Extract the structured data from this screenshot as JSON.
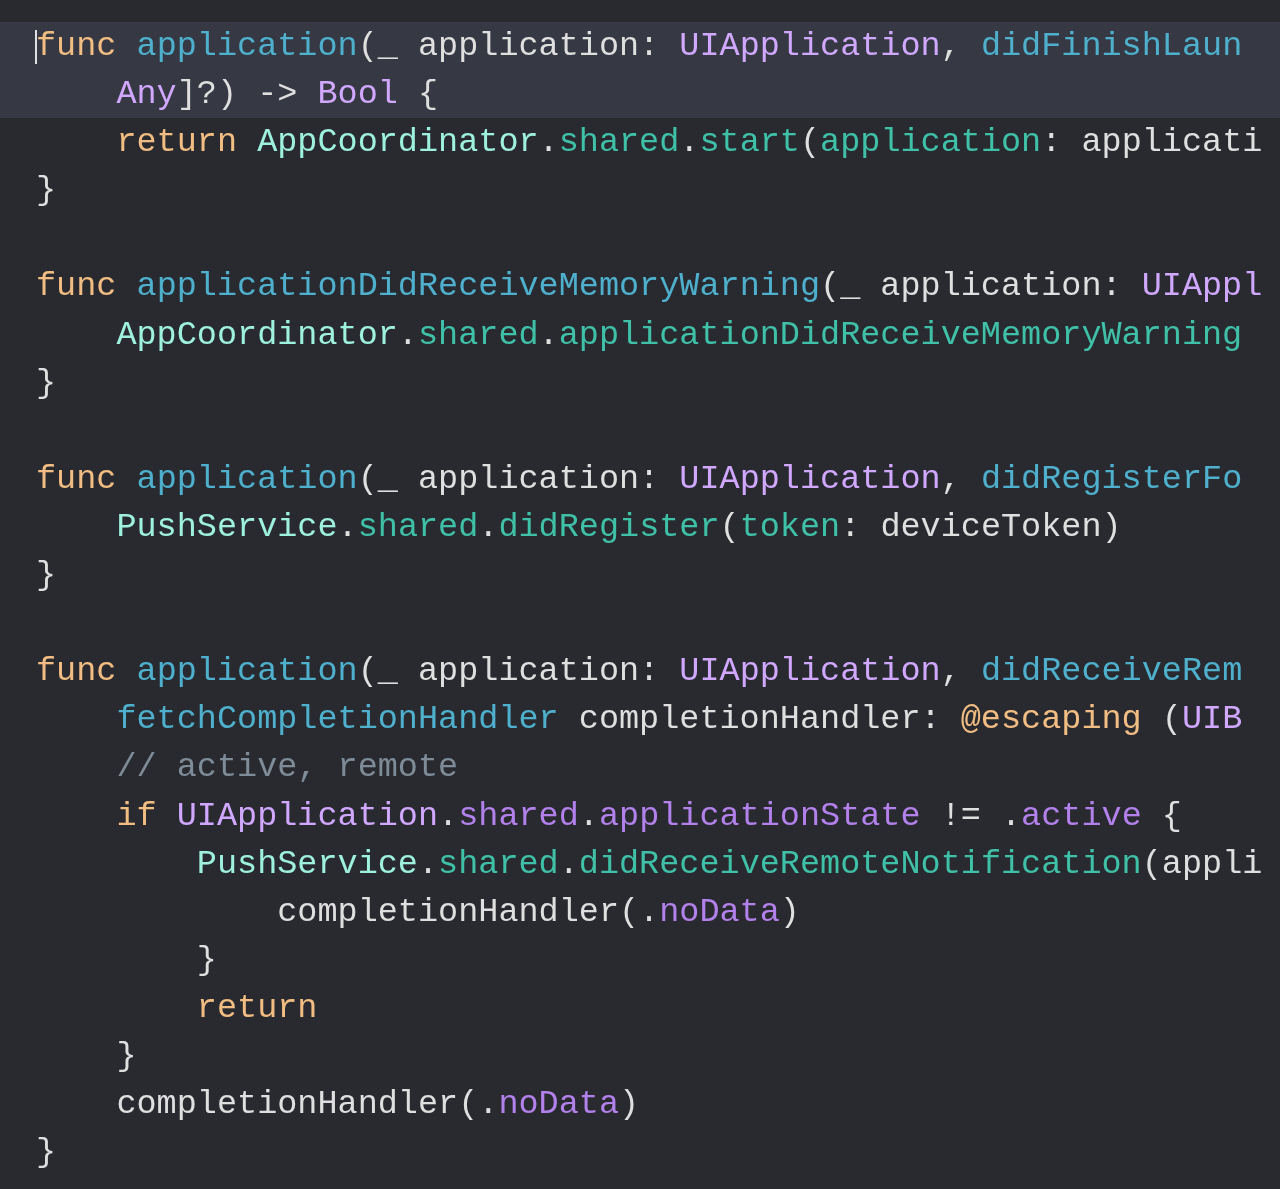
{
  "editor": {
    "lines": [
      {
        "current": true,
        "cursor": true,
        "tokens": [
          {
            "kind": "keyword",
            "text": "func "
          },
          {
            "kind": "decl",
            "text": "application"
          },
          {
            "kind": "plain",
            "text": "(_ application: "
          },
          {
            "kind": "type",
            "text": "UIApplication"
          },
          {
            "kind": "plain",
            "text": ", "
          },
          {
            "kind": "decl",
            "text": "didFinishLaun"
          }
        ]
      },
      {
        "current": true,
        "cursor": false,
        "tokens": [
          {
            "kind": "type",
            "text": "    Any"
          },
          {
            "kind": "plain",
            "text": "]?) -> "
          },
          {
            "kind": "type",
            "text": "Bool"
          },
          {
            "kind": "plain",
            "text": " {"
          }
        ]
      },
      {
        "current": false,
        "cursor": false,
        "tokens": [
          {
            "kind": "keyword",
            "text": "    return "
          },
          {
            "kind": "class",
            "text": "AppCoordinator"
          },
          {
            "kind": "plain",
            "text": "."
          },
          {
            "kind": "member",
            "text": "shared"
          },
          {
            "kind": "plain",
            "text": "."
          },
          {
            "kind": "member",
            "text": "start"
          },
          {
            "kind": "plain",
            "text": "("
          },
          {
            "kind": "member",
            "text": "application"
          },
          {
            "kind": "plain",
            "text": ": applicati"
          }
        ]
      },
      {
        "current": false,
        "cursor": false,
        "tokens": [
          {
            "kind": "plain",
            "text": "}"
          }
        ]
      },
      {
        "current": false,
        "cursor": false
      },
      {
        "current": false,
        "cursor": false,
        "tokens": [
          {
            "kind": "keyword",
            "text": "func "
          },
          {
            "kind": "decl",
            "text": "applicationDidReceiveMemoryWarning"
          },
          {
            "kind": "plain",
            "text": "(_ application: "
          },
          {
            "kind": "type",
            "text": "UIAppl"
          }
        ]
      },
      {
        "current": false,
        "cursor": false,
        "tokens": [
          {
            "kind": "class",
            "text": "    AppCoordinator"
          },
          {
            "kind": "plain",
            "text": "."
          },
          {
            "kind": "member",
            "text": "shared"
          },
          {
            "kind": "plain",
            "text": "."
          },
          {
            "kind": "member",
            "text": "applicationDidReceiveMemoryWarning"
          }
        ]
      },
      {
        "current": false,
        "cursor": false,
        "tokens": [
          {
            "kind": "plain",
            "text": "}"
          }
        ]
      },
      {
        "current": false,
        "cursor": false
      },
      {
        "current": false,
        "cursor": false,
        "tokens": [
          {
            "kind": "keyword",
            "text": "func "
          },
          {
            "kind": "decl",
            "text": "application"
          },
          {
            "kind": "plain",
            "text": "(_ application: "
          },
          {
            "kind": "type",
            "text": "UIApplication"
          },
          {
            "kind": "plain",
            "text": ", "
          },
          {
            "kind": "decl",
            "text": "didRegisterFo"
          }
        ]
      },
      {
        "current": false,
        "cursor": false,
        "tokens": [
          {
            "kind": "class",
            "text": "    PushService"
          },
          {
            "kind": "plain",
            "text": "."
          },
          {
            "kind": "member",
            "text": "shared"
          },
          {
            "kind": "plain",
            "text": "."
          },
          {
            "kind": "member",
            "text": "didRegister"
          },
          {
            "kind": "plain",
            "text": "("
          },
          {
            "kind": "member",
            "text": "token"
          },
          {
            "kind": "plain",
            "text": ": deviceToken)"
          }
        ]
      },
      {
        "current": false,
        "cursor": false,
        "tokens": [
          {
            "kind": "plain",
            "text": "}"
          }
        ]
      },
      {
        "current": false,
        "cursor": false
      },
      {
        "current": false,
        "cursor": false,
        "tokens": [
          {
            "kind": "keyword",
            "text": "func "
          },
          {
            "kind": "decl",
            "text": "application"
          },
          {
            "kind": "plain",
            "text": "(_ application: "
          },
          {
            "kind": "type",
            "text": "UIApplication"
          },
          {
            "kind": "plain",
            "text": ", "
          },
          {
            "kind": "decl",
            "text": "didReceiveRem"
          }
        ]
      },
      {
        "current": false,
        "cursor": false,
        "tokens": [
          {
            "kind": "decl",
            "text": "    fetchCompletionHandler"
          },
          {
            "kind": "plain",
            "text": " completionHandler: "
          },
          {
            "kind": "attribute",
            "text": "@escaping"
          },
          {
            "kind": "plain",
            "text": " ("
          },
          {
            "kind": "type",
            "text": "UIB"
          }
        ]
      },
      {
        "current": false,
        "cursor": false,
        "tokens": [
          {
            "kind": "comment",
            "text": "    // active, remote"
          }
        ]
      },
      {
        "current": false,
        "cursor": false,
        "tokens": [
          {
            "kind": "keyword",
            "text": "    if "
          },
          {
            "kind": "type",
            "text": "UIApplication"
          },
          {
            "kind": "plain",
            "text": "."
          },
          {
            "kind": "property",
            "text": "shared"
          },
          {
            "kind": "plain",
            "text": "."
          },
          {
            "kind": "property",
            "text": "applicationState"
          },
          {
            "kind": "plain",
            "text": " != ."
          },
          {
            "kind": "property",
            "text": "active"
          },
          {
            "kind": "plain",
            "text": " {"
          }
        ]
      },
      {
        "current": false,
        "cursor": false,
        "tokens": [
          {
            "kind": "class",
            "text": "        PushService"
          },
          {
            "kind": "plain",
            "text": "."
          },
          {
            "kind": "member",
            "text": "shared"
          },
          {
            "kind": "plain",
            "text": "."
          },
          {
            "kind": "member",
            "text": "didReceiveRemoteNotification"
          },
          {
            "kind": "plain",
            "text": "(appli"
          }
        ]
      },
      {
        "current": false,
        "cursor": false,
        "tokens": [
          {
            "kind": "plain",
            "text": "            completionHandler(."
          },
          {
            "kind": "property",
            "text": "noData"
          },
          {
            "kind": "plain",
            "text": ")"
          }
        ]
      },
      {
        "current": false,
        "cursor": false,
        "tokens": [
          {
            "kind": "plain",
            "text": "        }"
          }
        ]
      },
      {
        "current": false,
        "cursor": false,
        "tokens": [
          {
            "kind": "keyword",
            "text": "        return"
          }
        ]
      },
      {
        "current": false,
        "cursor": false,
        "tokens": [
          {
            "kind": "plain",
            "text": "    }"
          }
        ]
      },
      {
        "current": false,
        "cursor": false,
        "tokens": [
          {
            "kind": "plain",
            "text": "    completionHandler(."
          },
          {
            "kind": "property",
            "text": "noData"
          },
          {
            "kind": "plain",
            "text": ")"
          }
        ]
      },
      {
        "current": false,
        "cursor": false,
        "tokens": [
          {
            "kind": "plain",
            "text": "}"
          }
        ]
      }
    ]
  }
}
